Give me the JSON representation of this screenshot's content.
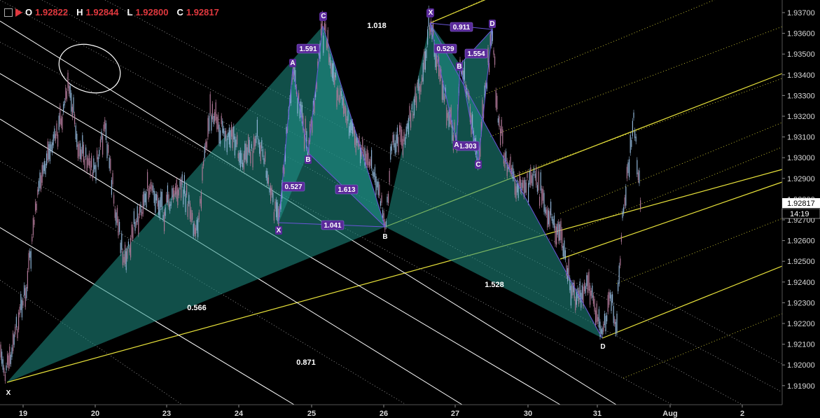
{
  "ohlc": {
    "open_label": "O",
    "open": "1.92822",
    "high_label": "H",
    "high": "1.92844",
    "low_label": "L",
    "low": "1.92800",
    "close_label": "C",
    "close": "1.92817"
  },
  "price_axis": {
    "current_price": "1.92817",
    "countdown": "14:19"
  },
  "colors": {
    "background": "#000000",
    "pattern_fill": "#1f8f85",
    "fib_line": "#e8e23a",
    "trend_line": "#ffffff",
    "label_box": "#5a2a9a",
    "candle": "#8fb3d6"
  },
  "chart_data": {
    "type": "candlestick",
    "title": "",
    "ylim": [
      1.919,
      1.9372
    ],
    "y_ticks": [
      "1.93700",
      "1.93600",
      "1.93500",
      "1.93400",
      "1.93300",
      "1.93200",
      "1.93100",
      "1.93000",
      "1.92900",
      "1.92800",
      "1.92700",
      "1.92600",
      "1.92500",
      "1.92400",
      "1.92300",
      "1.92200",
      "1.92100",
      "1.92000",
      "1.91900"
    ],
    "x_ticks": [
      "19",
      "20",
      "23",
      "24",
      "25",
      "26",
      "27",
      "30",
      "31",
      "Aug",
      "2"
    ],
    "patterns": [
      {
        "name": "large",
        "points": [
          {
            "label": "X",
            "date": "19",
            "price": 1.9198
          },
          {
            "label": "A",
            "date": "25",
            "price": 1.9364
          },
          {
            "label": "B",
            "date": "26",
            "price": 1.927
          },
          {
            "label": "C",
            "date": "27",
            "price": 1.9366
          },
          {
            "label": "D",
            "date": "31",
            "price": 1.9219
          }
        ]
      },
      {
        "name": "left_small",
        "points": [
          {
            "label": "X",
            "date": "24.6",
            "price": 1.9272
          },
          {
            "label": "A",
            "date": "24.7",
            "price": 1.9341
          },
          {
            "label": "B",
            "date": "24.9",
            "price": 1.9303
          },
          {
            "label": "C",
            "date": "25",
            "price": 1.9364
          },
          {
            "label": "D",
            "date": "26",
            "price": 1.927
          }
        ]
      },
      {
        "name": "right_small",
        "points": [
          {
            "label": "X",
            "date": "27",
            "price": 1.9366
          },
          {
            "label": "A",
            "date": "27",
            "price": 1.9312
          },
          {
            "label": "B",
            "date": "27",
            "price": 1.934
          },
          {
            "label": "C",
            "date": "27.3",
            "price": 1.9306
          },
          {
            "label": "D",
            "date": "27.5",
            "price": 1.9362
          }
        ]
      }
    ],
    "ratios_plain": [
      "1.018",
      "0.566",
      "0.871",
      "1.528"
    ],
    "ratios_boxed": [
      "1.591",
      "0.527",
      "1.613",
      "1.041",
      "0.911",
      "0.529",
      "1.554",
      "1.303"
    ],
    "point_labels_large": [
      "X",
      "A",
      "B",
      "C",
      "D"
    ],
    "point_labels_left": [
      "X",
      "A",
      "B",
      "C"
    ],
    "point_labels_right": [
      "X",
      "A",
      "B",
      "C",
      "D"
    ]
  }
}
